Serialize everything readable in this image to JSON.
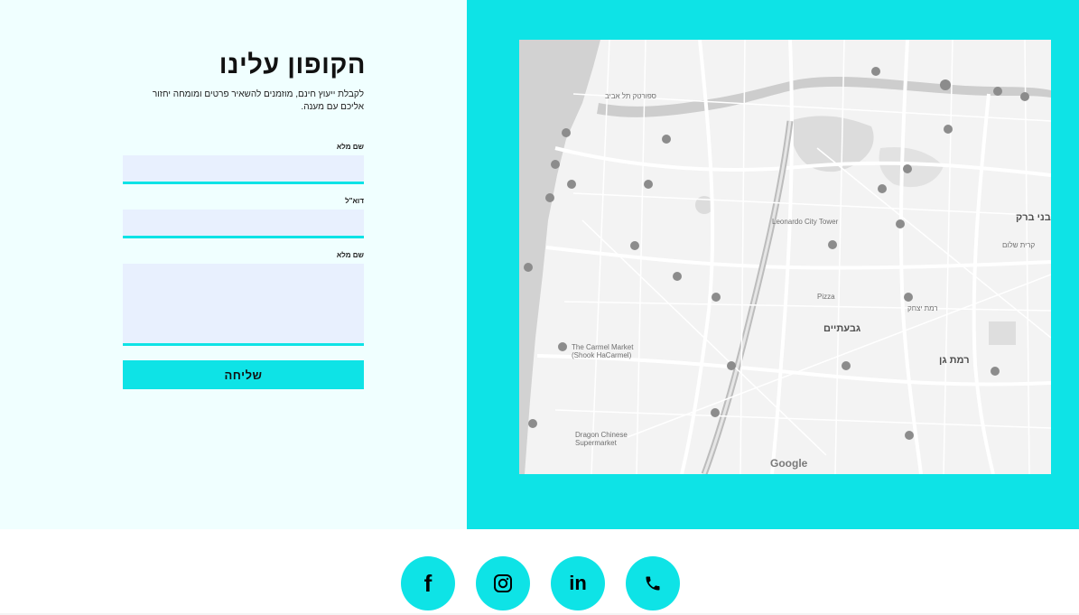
{
  "form": {
    "title": "הקופון עלינו",
    "subtitle": "לקבלת ייעוץ חינם, מוזמנים להשאיר פרטים ומומחה יחזור אליכם עם מענה.",
    "fields": [
      {
        "label": "שם מלא",
        "value": ""
      },
      {
        "label": "דוא\"ל",
        "value": ""
      },
      {
        "label": "שם מלא",
        "value": ""
      }
    ],
    "submit_label": "שליחה"
  },
  "map": {
    "labels": {
      "carmel_market": "The Carmel Market",
      "shook": "(Shook HaCarmel)",
      "leonardo": "Leonardo City Tower",
      "ramat_gan": "רמת גן",
      "givatayim": "גבעתיים",
      "bnei_brak": "בני ברק",
      "pizza": "Pizza",
      "dragon": "Dragon Chinese",
      "supermarket": "Supermarket",
      "google": "Google",
      "sportek": "ספורטק תל אביב",
      "ramat_yitzhak": "רמת יצחק",
      "kiryat_sholom": "קרית שלום"
    }
  },
  "socials": {
    "facebook_glyph": "f",
    "linkedin_glyph": "in",
    "accent": "#0ee3e6"
  },
  "colors": {
    "accent": "#0ee3e6",
    "panel_bg": "#f0ffff",
    "input_bg": "#e8f0fe"
  }
}
